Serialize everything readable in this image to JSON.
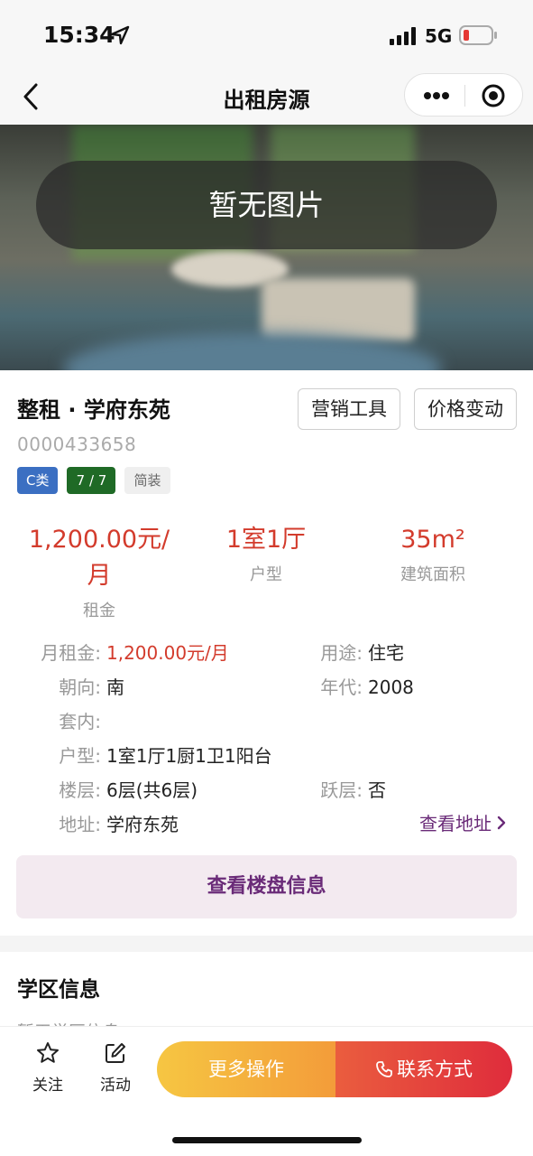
{
  "status_bar": {
    "time": "15:34",
    "network": "5G"
  },
  "nav": {
    "title": "出租房源"
  },
  "hero": {
    "overlay_text": "暂无图片"
  },
  "listing": {
    "title": "整租 · 学府东苑",
    "code": "0000433658",
    "buttons": {
      "marketing": "营销工具",
      "price_change": "价格变动"
    },
    "tags": {
      "category": "C类",
      "floor": "7 / 7",
      "decoration": "简装"
    },
    "stats": {
      "rent_value_line1": "1,200.00元/",
      "rent_value_line2": "月",
      "rent_label": "租金",
      "layout_value": "1室1厅",
      "layout_label": "户型",
      "area_value": "35m²",
      "area_label": "建筑面积"
    },
    "details": {
      "monthly_rent_label": "月租金:",
      "monthly_rent_value": "1,200.00元/月",
      "usage_label": "用途:",
      "usage_value": "住宅",
      "orientation_label": "朝向:",
      "orientation_value": "南",
      "year_label": "年代:",
      "year_value": "2008",
      "inner_label": "套内:",
      "inner_value": "",
      "layout_label": "户型:",
      "layout_value": "1室1厅1厨1卫1阳台",
      "floor_label": "楼层:",
      "floor_value": "6层(共6层)",
      "duplex_label": "跃层:",
      "duplex_value": "否",
      "address_label": "地址:",
      "address_value": "学府东苑"
    },
    "view_address": "查看地址",
    "view_building": "查看楼盘信息"
  },
  "school": {
    "title": "学区信息",
    "empty": "暂无学区信息"
  },
  "bottom": {
    "follow": "关注",
    "activity": "活动",
    "more_actions": "更多操作",
    "contact": "联系方式"
  },
  "colors": {
    "accent_red": "#d33b2c",
    "brand_purple": "#6a2b78",
    "tag_blue": "#3b6fc2",
    "tag_green": "#1f6a26"
  },
  "icons": [
    "location-arrow-icon",
    "signal-icon",
    "battery-icon",
    "back-arrow-icon",
    "more-dots-icon",
    "target-icon",
    "chevron-right-icon",
    "star-icon",
    "edit-icon",
    "phone-icon"
  ]
}
